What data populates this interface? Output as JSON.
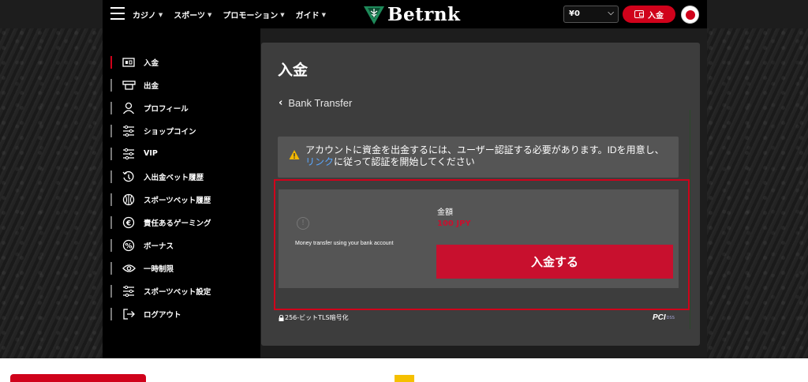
{
  "header": {
    "nav": [
      {
        "label": "カジノ"
      },
      {
        "label": "スポーツ"
      },
      {
        "label": "プロモーション"
      },
      {
        "label": "ガイド"
      }
    ],
    "logo_text": "Betrnk",
    "balance": "¥0",
    "deposit_label": "入金",
    "flag_colors": {
      "bg": "#ffffff",
      "circle": "#d0021b"
    }
  },
  "sidebar": {
    "items": [
      {
        "label": "入金",
        "icon": "deposit-icon",
        "active": true
      },
      {
        "label": "出金",
        "icon": "withdraw-icon"
      },
      {
        "label": "プロフィール",
        "icon": "profile-icon"
      },
      {
        "label": "ショップコイン",
        "icon": "sliders-icon"
      },
      {
        "label": "VIP",
        "icon": "sliders-icon"
      },
      {
        "label": "入出金ベット履歴",
        "icon": "history-icon"
      },
      {
        "label": "スポーツベット履歴",
        "icon": "ball-icon"
      },
      {
        "label": "責任あるゲーミング",
        "icon": "euro-icon"
      },
      {
        "label": "ボーナス",
        "icon": "percent-icon"
      },
      {
        "label": "一時制限",
        "icon": "eye-icon"
      },
      {
        "label": "スポーツベット設定",
        "icon": "sliders-icon"
      },
      {
        "label": "ログアウト",
        "icon": "logout-icon"
      }
    ]
  },
  "main": {
    "title": "入金",
    "back_label": "Bank Transfer",
    "notice": {
      "text_before": "アカウントに資金を出金するには、ユーザー認証する必要があります。IDを用意し、",
      "link": "リンク",
      "text_after": "に従って認証を開始してください"
    },
    "method": {
      "description": "Money transfer using your bank account",
      "amount_label": "金額",
      "amount_value": "100 JPY",
      "submit_label": "入金する"
    },
    "security_label": "256-ビットTLS暗号化",
    "pci_label": "PCI",
    "pci_sub": "DSS"
  },
  "colors": {
    "accent": "#d0021b",
    "panel": "#3d3d3d",
    "card": "#555555",
    "link": "#5ba8ff"
  }
}
